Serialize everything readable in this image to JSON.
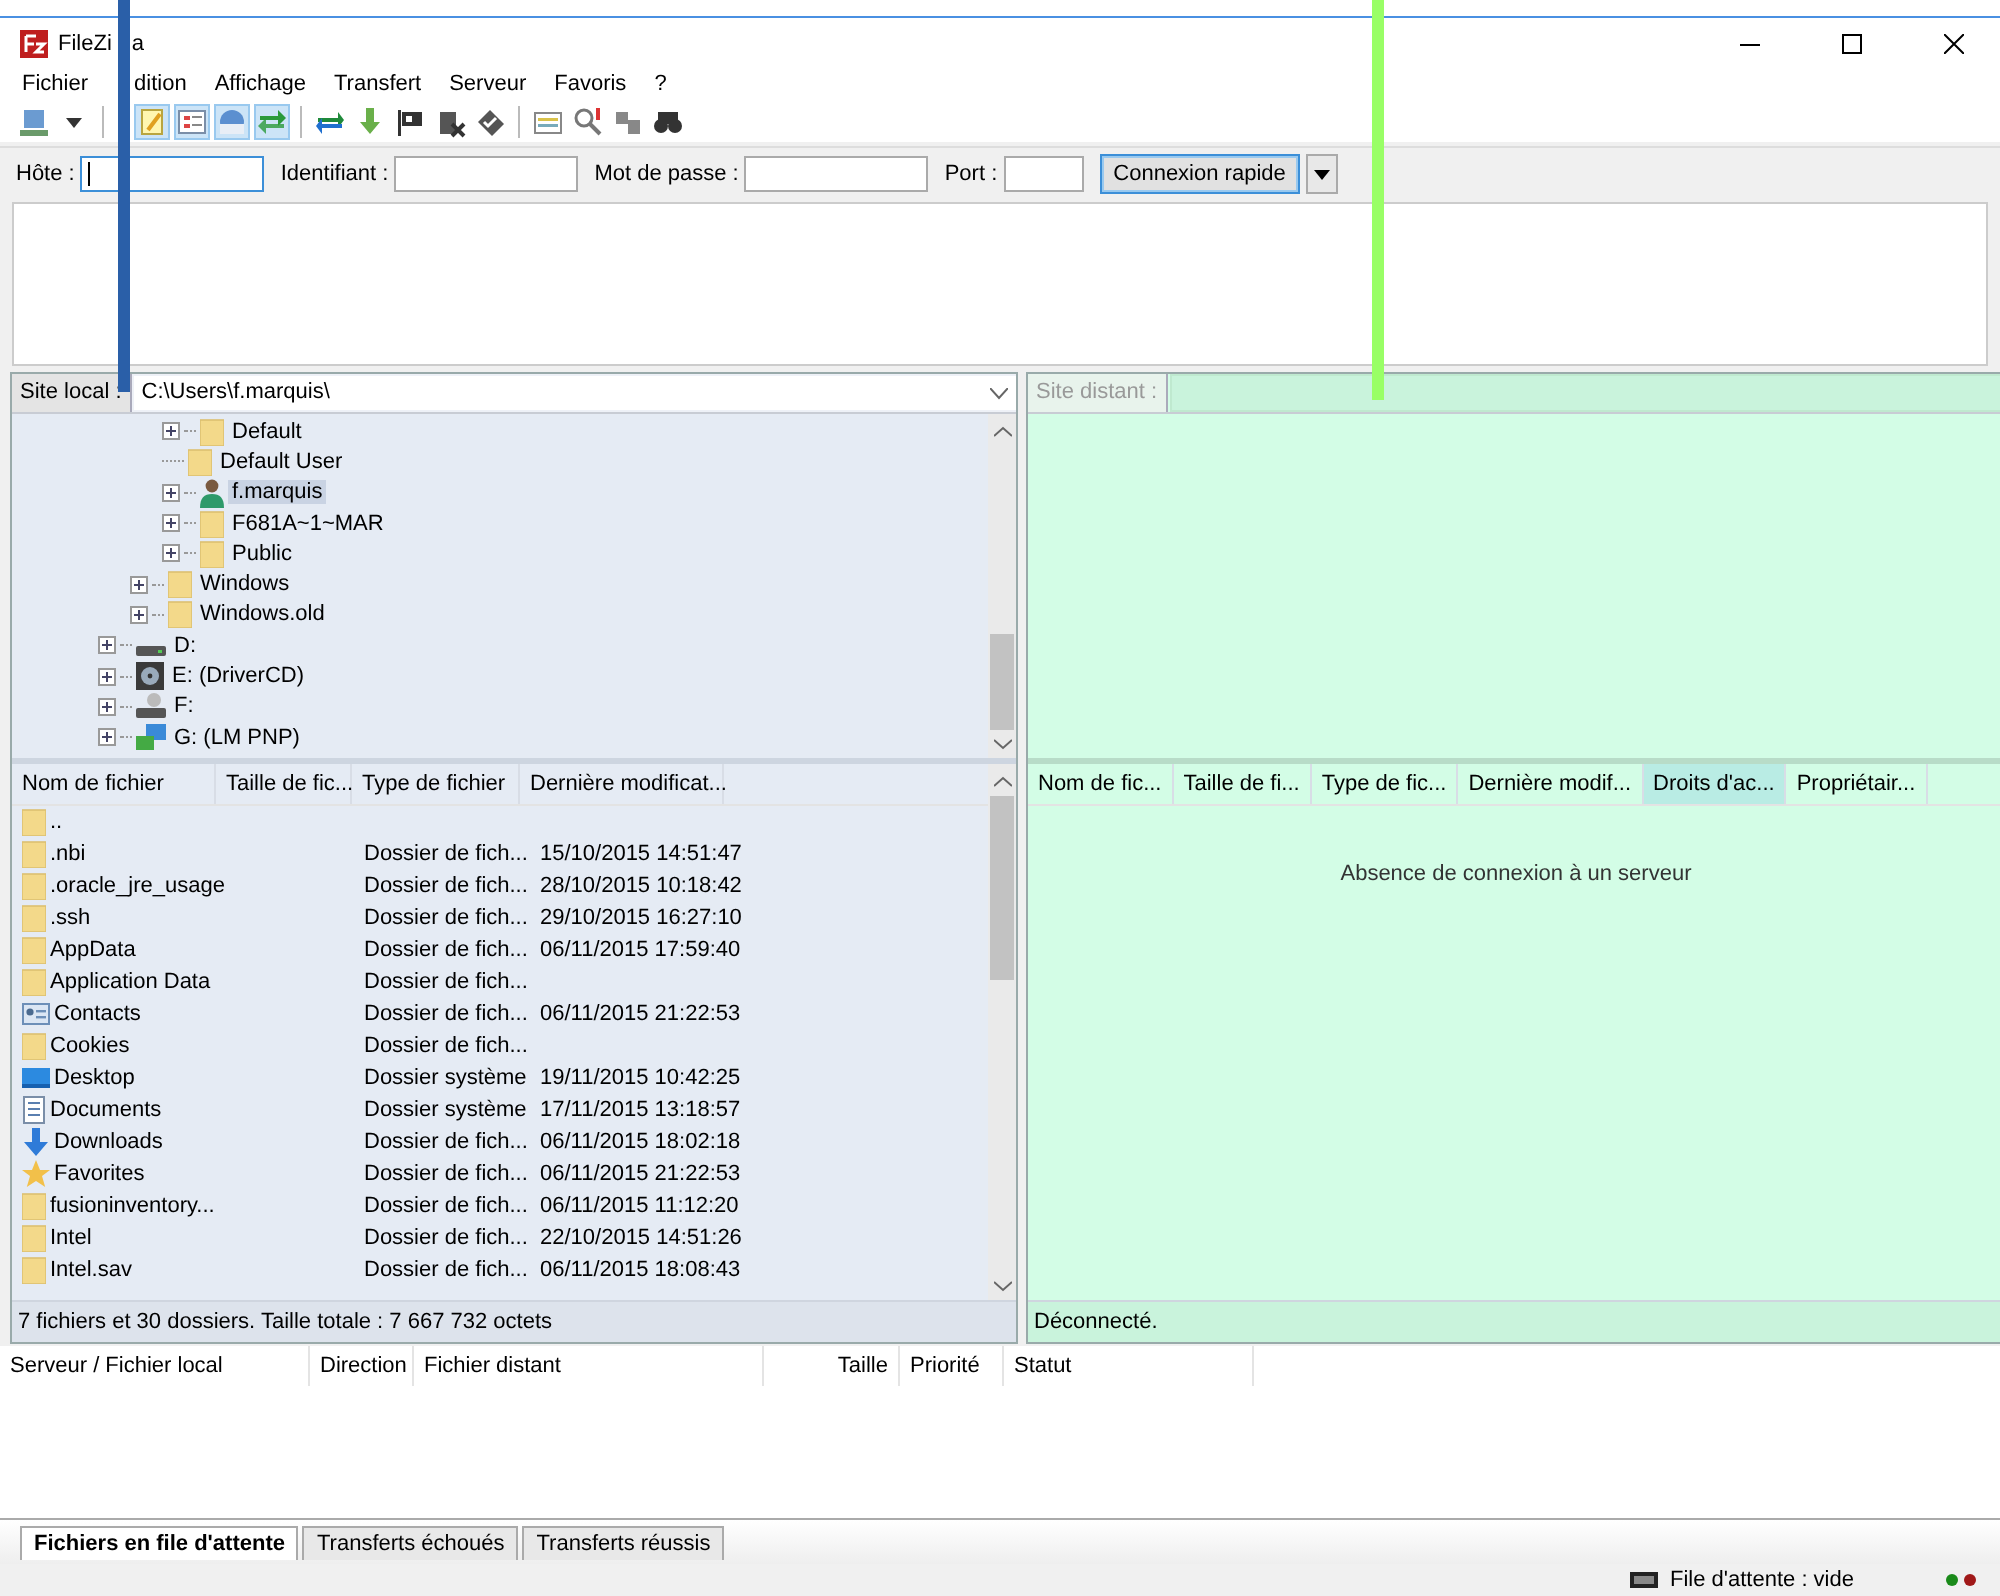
{
  "window": {
    "title": "FileZi",
    "title_tail": "a"
  },
  "menu": [
    "Fichier",
    "dition",
    "Affichage",
    "Transfert",
    "Serveur",
    "Favoris",
    "?"
  ],
  "toolbar": [
    {
      "kind": "server",
      "pressed": false
    },
    {
      "kind": "caret",
      "pressed": false
    },
    {
      "kind": "sep"
    },
    {
      "kind": "note",
      "pressed": true
    },
    {
      "kind": "tree",
      "pressed": true
    },
    {
      "kind": "globe",
      "pressed": true
    },
    {
      "kind": "arrows",
      "pressed": true
    },
    {
      "kind": "sep"
    },
    {
      "kind": "refresh",
      "pressed": false
    },
    {
      "kind": "download",
      "pressed": false
    },
    {
      "kind": "flag",
      "pressed": false
    },
    {
      "kind": "cancel",
      "pressed": false
    },
    {
      "kind": "check",
      "pressed": false
    },
    {
      "kind": "sep"
    },
    {
      "kind": "table",
      "pressed": false
    },
    {
      "kind": "search",
      "pressed": false
    },
    {
      "kind": "compare",
      "pressed": false
    },
    {
      "kind": "binoculars",
      "pressed": false
    }
  ],
  "quickconnect": {
    "fields": [
      {
        "label": "Hôte :",
        "focused": true
      },
      {
        "label": "Identifiant :",
        "focused": false
      },
      {
        "label": "Mot de passe :",
        "focused": false
      },
      {
        "label": "Port :",
        "focused": false
      }
    ],
    "button": "Connexion rapide"
  },
  "local": {
    "site_label": "Site local :",
    "path": "C:\\Users\\f.marquis\\",
    "tree": [
      {
        "children": [
          {
            "children": [
              {
                "label": "Default",
                "kind": "folder",
                "has_children": true,
                "selected": false
              },
              {
                "label": "Default User",
                "kind": "folder",
                "has_children": false,
                "selected": false
              },
              {
                "label": "f.marquis",
                "kind": "user",
                "has_children": true,
                "selected": true
              },
              {
                "label": "F681A~1~MAR",
                "kind": "folder",
                "has_children": true,
                "selected": false
              },
              {
                "label": "Public",
                "kind": "folder",
                "has_children": true,
                "selected": false
              }
            ]
          },
          {
            "label": "Windows",
            "kind": "folder",
            "has_children": true,
            "selected": false
          },
          {
            "label": "Windows.old",
            "kind": "folder",
            "has_children": true,
            "selected": false
          }
        ]
      },
      {
        "label": "D:",
        "kind": "drive",
        "has_children": true,
        "selected": false
      },
      {
        "label": "E: (DriverCD)",
        "kind": "cd",
        "has_children": true,
        "selected": false
      },
      {
        "label": "F:",
        "kind": "netdrive",
        "has_children": true,
        "selected": false
      },
      {
        "label": "G: (LM PNP)",
        "kind": "device",
        "has_children": true,
        "selected": false
      }
    ],
    "columns": [
      "Nom de fichier",
      "Taille de fic...",
      "Type de fichier",
      "Dernière modificat..."
    ],
    "rows": [
      {
        "kind": "folder",
        "name": ".."
      },
      {
        "kind": "folder",
        "name": ".nbi",
        "type": "Dossier de fich...",
        "date": "15/10/2015 14:51:47"
      },
      {
        "kind": "folder",
        "name": ".oracle_jre_usage",
        "type": "Dossier de fich...",
        "date": "28/10/2015 10:18:42"
      },
      {
        "kind": "folder",
        "name": ".ssh",
        "type": "Dossier de fich...",
        "date": "29/10/2015 16:27:10"
      },
      {
        "kind": "folder",
        "name": "AppData",
        "type": "Dossier de fich...",
        "date": "06/11/2015 17:59:40"
      },
      {
        "kind": "folder",
        "name": "Application Data",
        "type": "Dossier de fich..."
      },
      {
        "kind": "contacts",
        "name": "Contacts",
        "type": "Dossier de fich...",
        "date": "06/11/2015 21:22:53"
      },
      {
        "kind": "folder",
        "name": "Cookies",
        "type": "Dossier de fich..."
      },
      {
        "kind": "desktop",
        "name": "Desktop",
        "type": "Dossier système",
        "date": "19/11/2015 10:42:25"
      },
      {
        "kind": "document",
        "name": "Documents",
        "type": "Dossier système",
        "date": "17/11/2015 13:18:57"
      },
      {
        "kind": "download",
        "name": "Downloads",
        "type": "Dossier de fich...",
        "date": "06/11/2015 18:02:18"
      },
      {
        "kind": "star",
        "name": "Favorites",
        "type": "Dossier de fich...",
        "date": "06/11/2015 21:22:53"
      },
      {
        "kind": "folder",
        "name": "fusioninventory...",
        "type": "Dossier de fich...",
        "date": "06/11/2015 11:12:20"
      },
      {
        "kind": "folder",
        "name": "Intel",
        "type": "Dossier de fich...",
        "date": "22/10/2015 14:51:26"
      },
      {
        "kind": "folder",
        "name": "Intel.sav",
        "type": "Dossier de fich...",
        "date": "06/11/2015 18:08:43"
      }
    ],
    "status": "7 fichiers et 30 dossiers. Taille totale : 7 667 732 octets"
  },
  "remote": {
    "site_label": "Site distant :",
    "disabled": true,
    "columns": [
      {
        "label": "Nom de fic...",
        "highlighted": false
      },
      {
        "label": "Taille de fi...",
        "highlighted": false
      },
      {
        "label": "Type de fic...",
        "highlighted": false
      },
      {
        "label": "Dernière modif...",
        "highlighted": false
      },
      {
        "label": "Droits d'ac...",
        "highlighted": true
      },
      {
        "label": "Propriétair...",
        "highlighted": false
      }
    ],
    "message": "Absence de connexion à un serveur",
    "status": "Déconnecté."
  },
  "queue": {
    "columns": [
      "Serveur / Fichier local",
      "Direction",
      "Fichier distant",
      "Taille",
      "Priorité",
      "Statut"
    ],
    "tabs": [
      {
        "label": "Fichiers en file d'attente",
        "selected": true
      },
      {
        "label": "Transferts échoués",
        "selected": false
      },
      {
        "label": "Transferts réussis",
        "selected": false
      }
    ],
    "status": "File d'attente : vide"
  },
  "annotations": [
    {
      "color": "#2a5fa8"
    },
    {
      "color": "#99ff66"
    }
  ]
}
